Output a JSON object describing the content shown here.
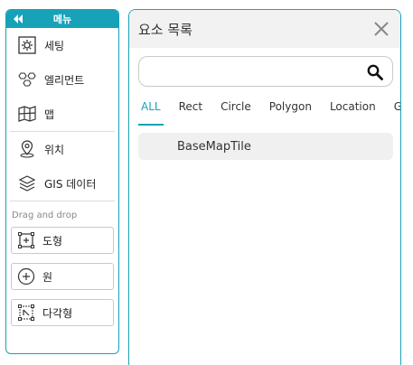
{
  "menu": {
    "title": "메뉴",
    "items": [
      {
        "label": "세팅",
        "icon": "gear-icon"
      },
      {
        "label": "엘리먼트",
        "icon": "elements-icon"
      },
      {
        "label": "맵",
        "icon": "map-icon"
      },
      {
        "label": "위치",
        "icon": "location-pin-icon"
      },
      {
        "label": "GIS 데이터",
        "icon": "layers-icon"
      }
    ],
    "dnd_label": "Drag and drop",
    "shapes": [
      {
        "label": "도형",
        "icon": "rect-add-icon"
      },
      {
        "label": "원",
        "icon": "circle-add-icon"
      },
      {
        "label": "다각형",
        "icon": "polygon-icon"
      }
    ]
  },
  "element_list": {
    "title": "요소 목록",
    "search": {
      "value": "",
      "placeholder": ""
    },
    "tabs": [
      {
        "label": "ALL",
        "active": true
      },
      {
        "label": "Rect"
      },
      {
        "label": "Circle"
      },
      {
        "label": "Polygon"
      },
      {
        "label": "Location"
      },
      {
        "label": "GIS"
      }
    ],
    "items": [
      {
        "label": "BaseMapTile"
      }
    ]
  },
  "colors": {
    "accent": "#17a2b8"
  }
}
